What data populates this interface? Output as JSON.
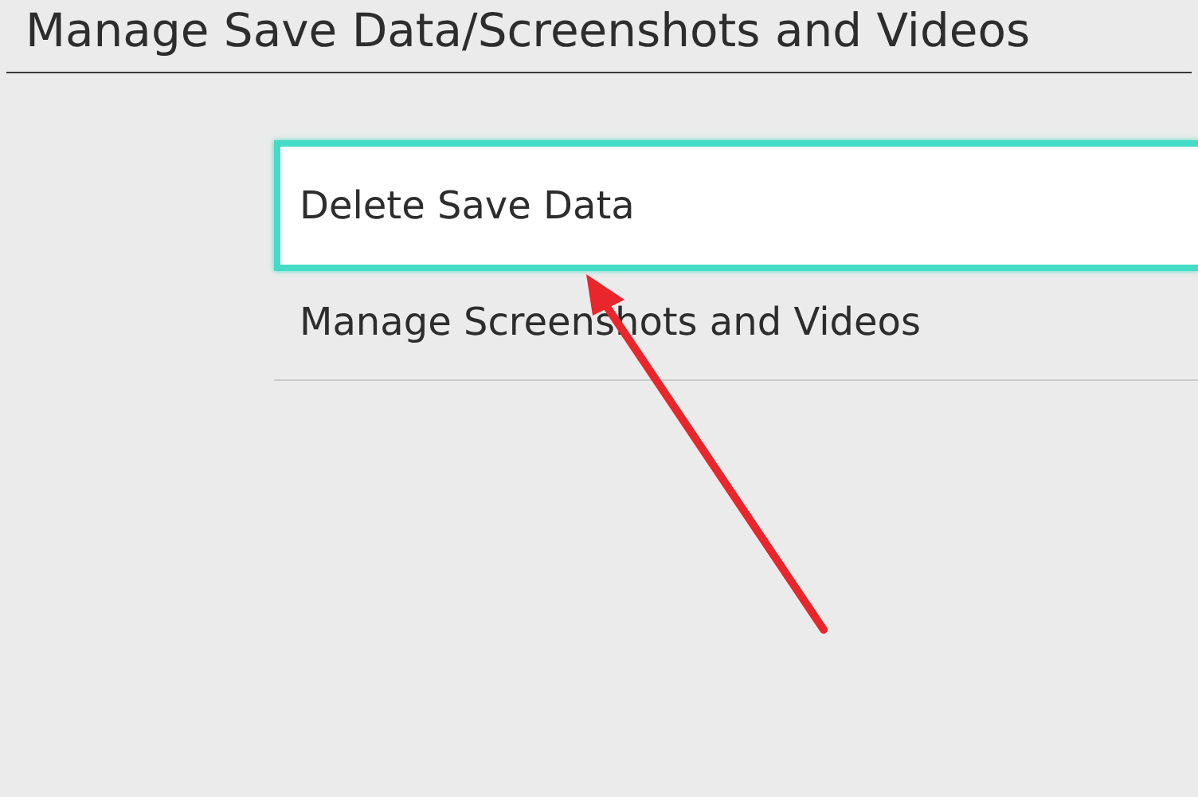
{
  "header": {
    "title": "Manage Save Data/Screenshots and Videos"
  },
  "menu": [
    {
      "label": "Delete Save Data",
      "selected": true
    },
    {
      "label": "Manage Screenshots and Videos",
      "selected": false
    }
  ],
  "annotation": {
    "kind": "arrow"
  }
}
